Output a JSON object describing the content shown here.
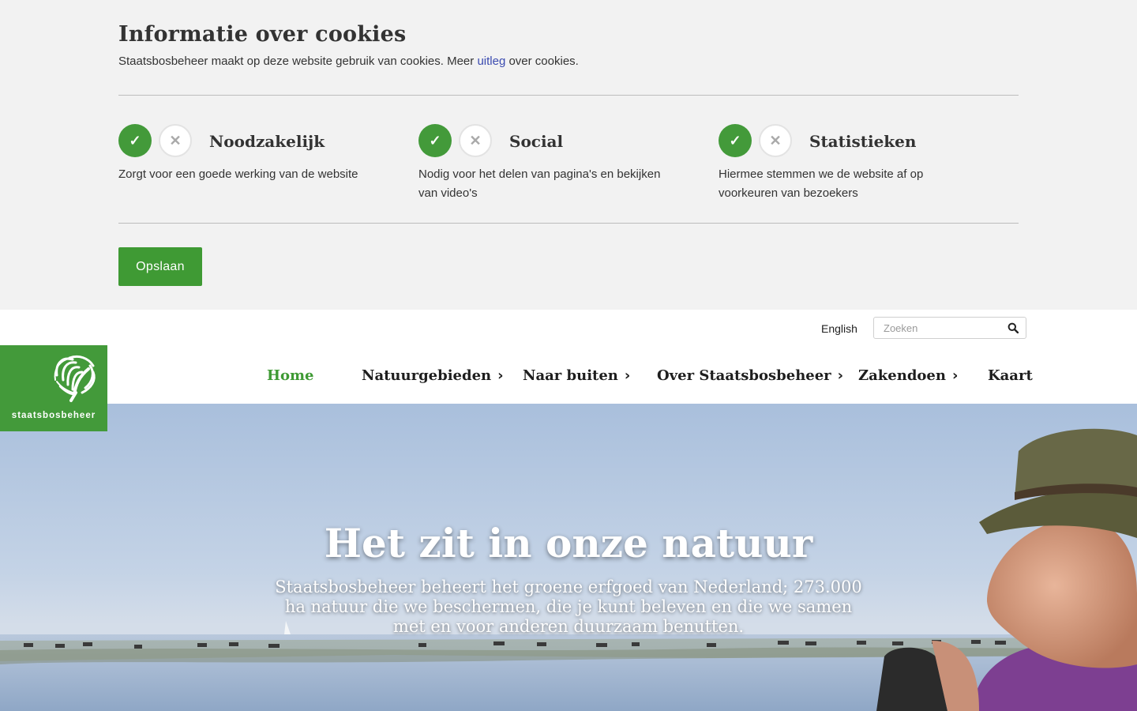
{
  "cookie_banner": {
    "title": "Informatie over cookies",
    "text_before": "Staatsbosbeheer maakt op deze website gebruik van cookies. Meer ",
    "link": "uitleg",
    "text_after": " over cookies.",
    "options": [
      {
        "label": "Noodzakelijk",
        "description": "Zorgt voor een goede werking van de website",
        "accepted": true
      },
      {
        "label": "Social",
        "description": "Nodig voor het delen van pagina's en bekijken van video's",
        "accepted": true
      },
      {
        "label": "Statistieken",
        "description": "Hiermee stemmen we de website af op voorkeuren van bezoekers",
        "accepted": true
      }
    ],
    "save_label": "Opslaan"
  },
  "header": {
    "language_link": "English",
    "search_placeholder": "Zoeken",
    "logo_text": "staatsbosbeheer",
    "nav": [
      {
        "label": "Home",
        "active": true
      },
      {
        "label": "Natuurgebieden",
        "has_submenu": true
      },
      {
        "label": "Naar buiten",
        "has_submenu": true
      },
      {
        "label": "Over Staatsbosbeheer",
        "has_submenu": true
      },
      {
        "label": "Zakendoen",
        "has_submenu": true
      },
      {
        "label": "Kaart"
      }
    ],
    "chevron": "›"
  },
  "hero": {
    "title": "Het zit in onze natuur",
    "subtitle": "Staatsbosbeheer beheert het groene erfgoed van Nederland; 273.000 ha natuur die we beschermen, die je kunt beleven en die we samen met en voor anderen duurzaam benutten."
  },
  "colors": {
    "brand_green": "#439a3a",
    "banner_bg": "#f2f2f2",
    "link_blue": "#3b4bb0"
  }
}
